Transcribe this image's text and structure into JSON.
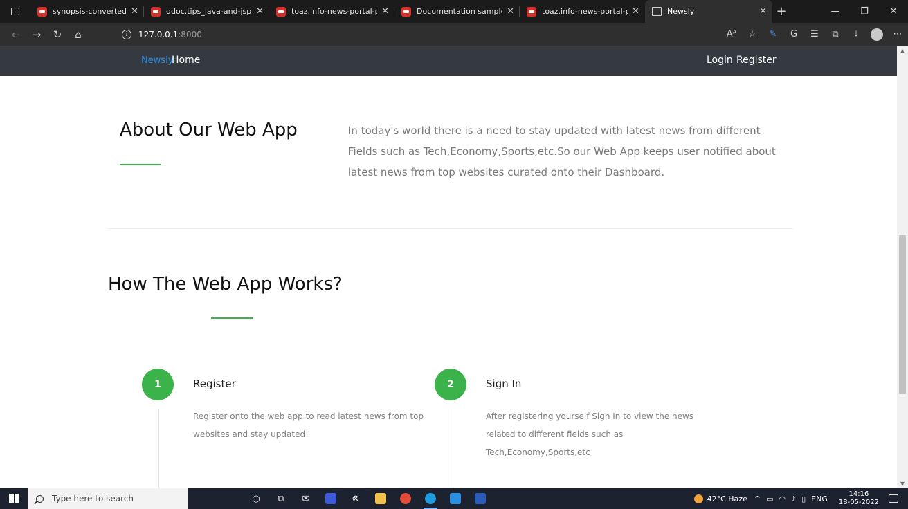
{
  "browser": {
    "tabs": [
      {
        "title": "synopsis-converted.pdf",
        "icon": "pdf-icon"
      },
      {
        "title": "qdoc.tips_java-and-jsp-proj",
        "icon": "pdf-icon"
      },
      {
        "title": "toaz.info-news-portal-proje",
        "icon": "pdf-icon"
      },
      {
        "title": "Documentation sample - Ed",
        "icon": "pdf-icon"
      },
      {
        "title": "toaz.info-news-portal-proje",
        "icon": "pdf-icon"
      },
      {
        "title": "Newsly",
        "icon": "page-icon",
        "active": true
      }
    ],
    "url_host": "127.0.0.1",
    "url_port": ":8000"
  },
  "navbar": {
    "brand": "Newsly",
    "home": "Home",
    "login": "Login",
    "register": "Register"
  },
  "about": {
    "title": "About Our Web App",
    "text": "In today's world there is a need to stay updated with latest news from different Fields such as Tech,Economy,Sports,etc.So our Web App keeps user notified about latest news from top websites curated onto their Dashboard."
  },
  "how": {
    "title": "How The Web App Works?",
    "steps": [
      {
        "number": "1",
        "title": "Register",
        "desc": "Register onto the web app to read latest news from top websites and stay updated!"
      },
      {
        "number": "2",
        "title": "Sign In",
        "desc": "After registering yourself Sign In to view the news related to different fields such as Tech,Economy,Sports,etc"
      }
    ]
  },
  "taskbar": {
    "search_placeholder": "Type here to search",
    "weather": "42°C  Haze",
    "language": "ENG",
    "time": "14:16",
    "date": "18-05-2022"
  },
  "colors": {
    "accent_green": "#3cb24a",
    "brand_blue": "#2f8ee6",
    "navbar_bg": "#343a40"
  }
}
